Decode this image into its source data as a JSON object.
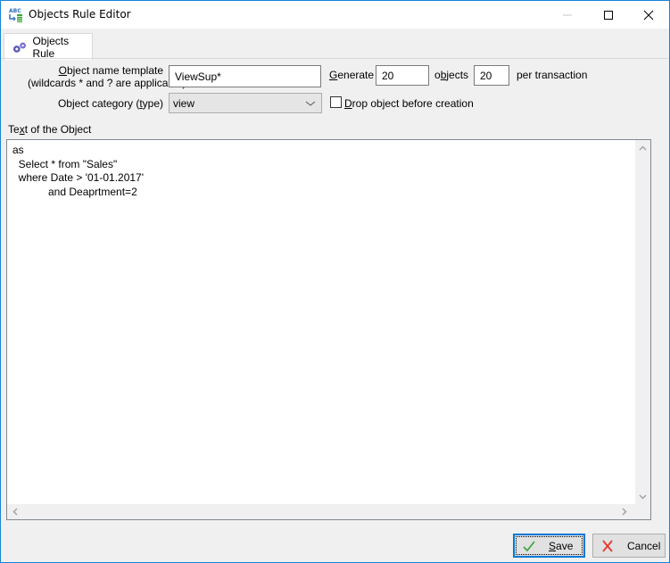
{
  "window": {
    "title": "Objects Rule Editor",
    "controls": {
      "minimize": "minimize",
      "maximize": "maximize",
      "close": "close"
    }
  },
  "tabs": [
    {
      "label": "Objects Rule",
      "icon": "gears-icon",
      "active": true
    }
  ],
  "form": {
    "name_template": {
      "label_line1": "bject name template",
      "label_accel": "O",
      "label_line2": "(wildcards * and ? are applicable)",
      "value": "ViewSup*"
    },
    "generate": {
      "label_accel": "G",
      "label_rest": "enerate",
      "value": "20"
    },
    "objects": {
      "label_pre": "o",
      "label_accel": "b",
      "label_rest": "jects",
      "value": "20"
    },
    "per_transaction_label": "per transaction",
    "category": {
      "label_pre": "Object category (",
      "label_accel": "t",
      "label_rest": "ype)",
      "value": "view"
    },
    "drop_before": {
      "label_accel": "D",
      "label_rest": "rop object before creation",
      "checked": false
    }
  },
  "editor": {
    "label_pre": "Te",
    "label_accel": "x",
    "label_rest": "t of the Object",
    "text": "as\n  Select * from \"Sales\"\n  where Date > '01-01.2017'\n            and Deaprtment=2"
  },
  "buttons": {
    "save": {
      "accel": "S",
      "rest": "ave",
      "icon": "checkmark-icon",
      "default": true
    },
    "cancel": {
      "label": "Cancel",
      "icon": "x-icon"
    }
  },
  "colors": {
    "window_border": "#1883d7",
    "focus_border": "#0078d7",
    "save_check": "#3ca23c",
    "cancel_x": "#e8382d"
  }
}
